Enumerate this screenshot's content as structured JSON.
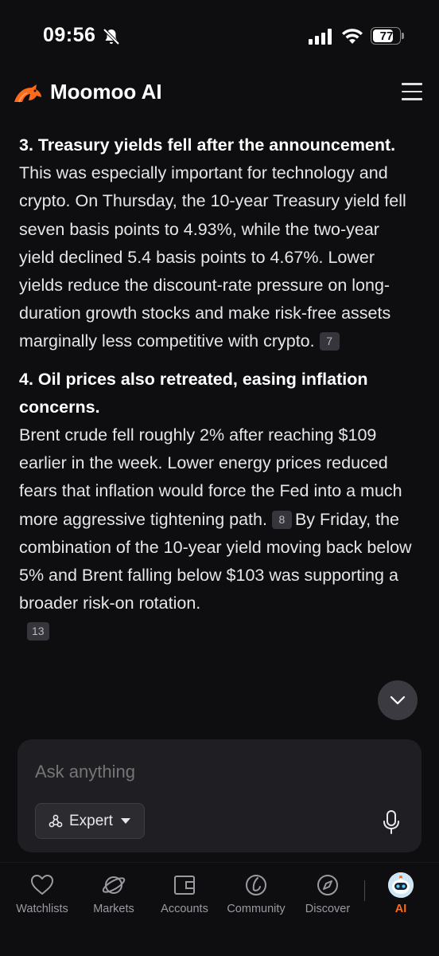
{
  "status_bar": {
    "time": "09:56",
    "battery": "77",
    "battery_level": 0.77
  },
  "header": {
    "title": "Moomoo AI"
  },
  "message": {
    "section3": {
      "heading": "3. Treasury yields fell after the announcement.",
      "body": "This was especially important for technology and crypto. On Thursday, the 10-year Treasury yield fell seven basis points to 4.93%, while the two-year yield declined 5.4 basis points to 4.67%. Lower yields reduce the discount-rate pressure on long-duration growth stocks and make risk-free assets marginally less competitive with crypto.",
      "citation": "7"
    },
    "section4": {
      "heading": "4. Oil prices also retreated, easing inflation concerns.",
      "body_part1": "Brent crude fell roughly 2% after reaching $109 earlier in the week. Lower energy prices reduced fears that inflation would force the Fed into a much more aggressive tightening path.",
      "citation1": "8",
      "body_part2": "By Friday, the combination of the 10-year yield moving back below 5% and Brent falling below $103 was supporting a broader risk-on rotation.",
      "citation2": "13"
    }
  },
  "composer": {
    "placeholder": "Ask anything",
    "mode_label": "Expert"
  },
  "bottom_nav": {
    "items": [
      {
        "label": "Watchlists",
        "icon": "heart-icon"
      },
      {
        "label": "Markets",
        "icon": "planet-icon"
      },
      {
        "label": "Accounts",
        "icon": "wallet-icon"
      },
      {
        "label": "Community",
        "icon": "community-icon"
      },
      {
        "label": "Discover",
        "icon": "compass-icon"
      },
      {
        "label": "AI",
        "icon": "ai-avatar-icon"
      }
    ],
    "active": "AI"
  },
  "colors": {
    "accent": "#ff6a1a",
    "background": "#0e0e10",
    "composer_bg": "#1f1f23"
  }
}
